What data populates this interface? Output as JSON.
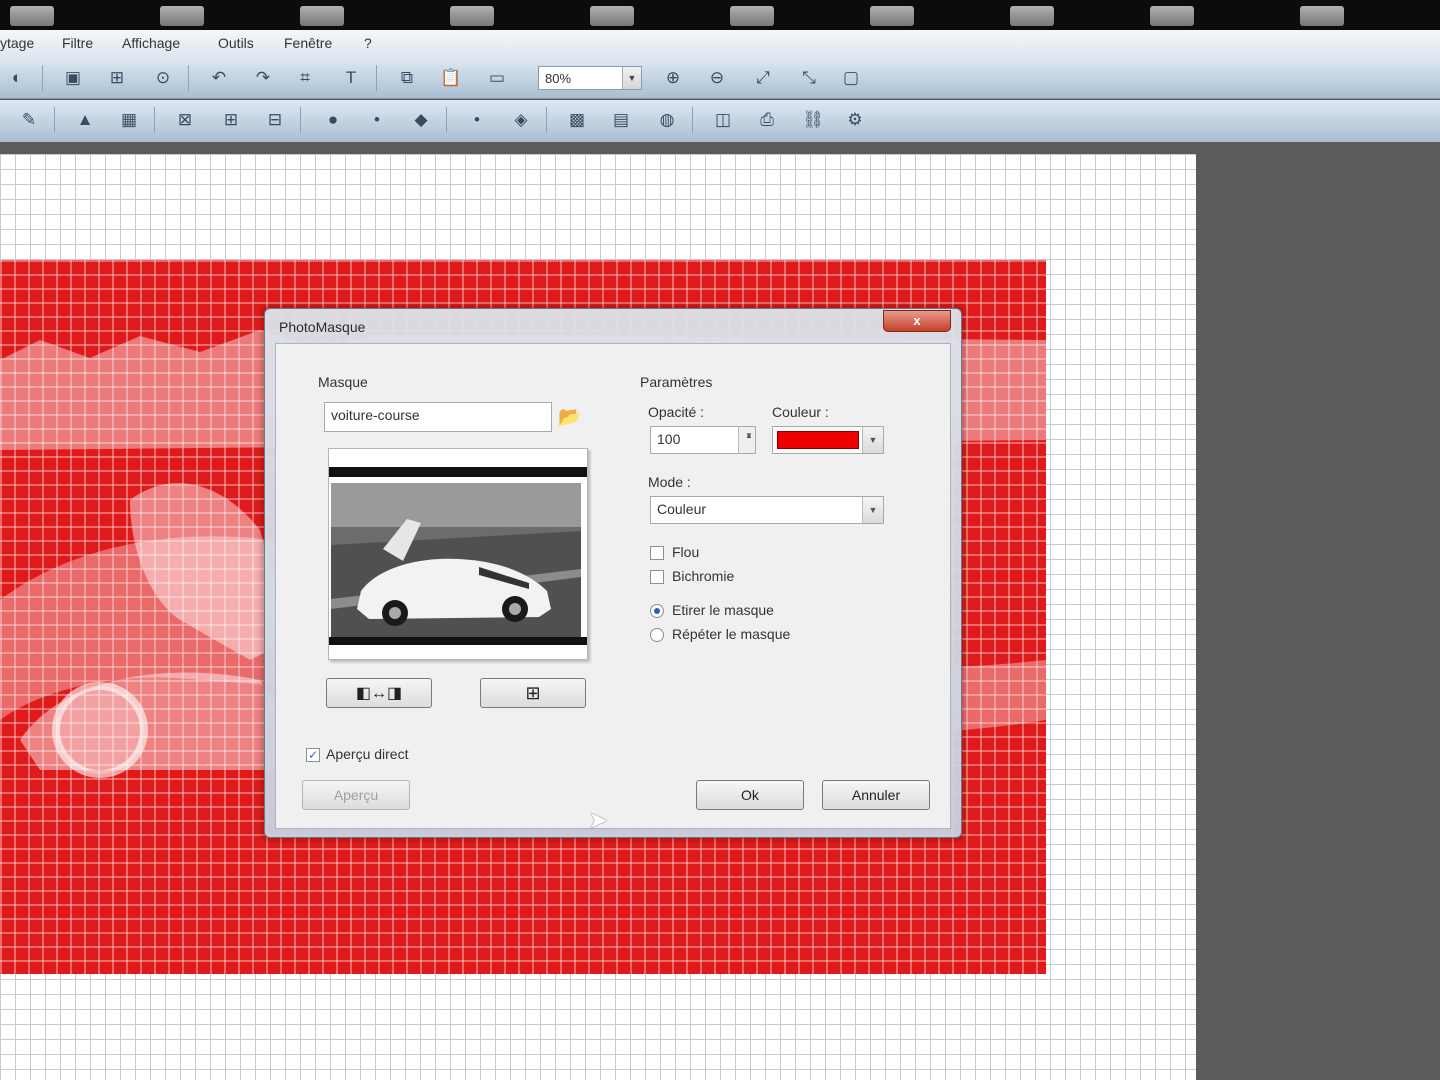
{
  "menubar": {
    "items": [
      "ytage",
      "Filtre",
      "Affichage",
      "Outils",
      "Fenêtre",
      "?"
    ]
  },
  "toolbar1": {
    "zoom_value": "80%"
  },
  "dialog": {
    "title": "PhotoMasque",
    "close_label": "x",
    "mask_section_label": "Masque",
    "mask_file_value": "voiture-course",
    "params_section_label": "Paramètres",
    "opacity_label": "Opacité :",
    "opacity_value": "100",
    "color_label": "Couleur :",
    "color_value": "#ee0000",
    "mode_label": "Mode :",
    "mode_value": "Couleur",
    "blur_label": "Flou",
    "bichromy_label": "Bichromie",
    "stretch_label": "Etirer le masque",
    "repeat_label": "Répéter le masque",
    "live_preview_label": "Aperçu direct",
    "preview_button": "Aperçu",
    "ok_button": "Ok",
    "cancel_button": "Annuler"
  }
}
